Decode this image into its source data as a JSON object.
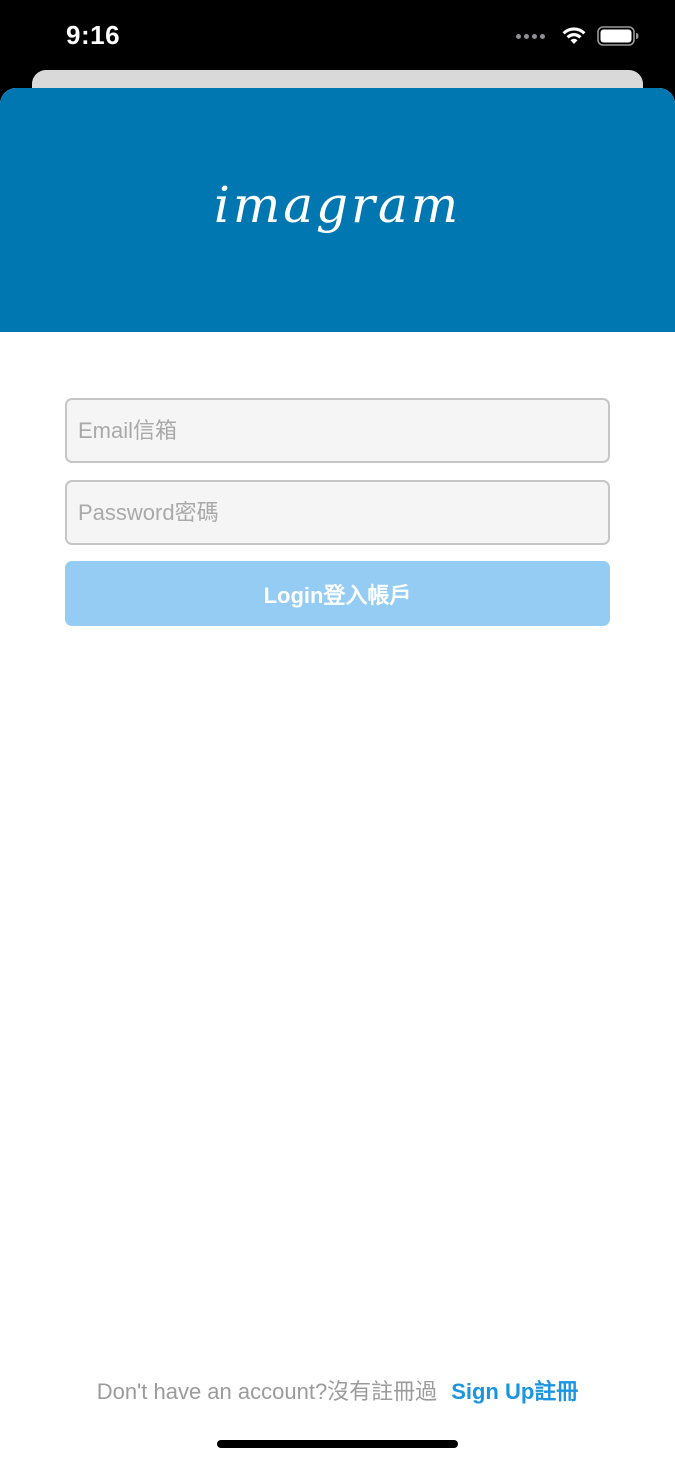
{
  "status_bar": {
    "time": "9:16",
    "icons": [
      "cellular-signal-icon",
      "wifi-icon",
      "battery-icon"
    ]
  },
  "header": {
    "logo_text": "imagram",
    "background_color": "#0077b1"
  },
  "form": {
    "email_placeholder": "Email信箱",
    "email_value": "",
    "password_placeholder": "Password密碼",
    "password_value": "",
    "login_label": "Login登入帳戶",
    "login_button_color": "#95ccf4"
  },
  "footer": {
    "signup_prompt": "Don't have an account?沒有註冊過",
    "signup_link": "Sign Up註冊",
    "link_color": "#1b95e0"
  }
}
